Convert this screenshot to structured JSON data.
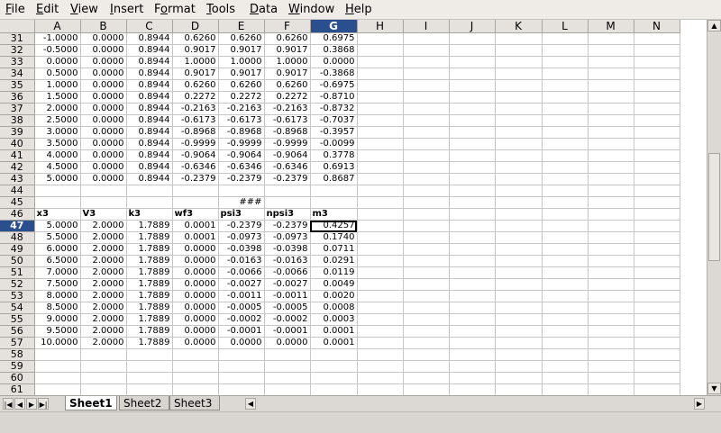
{
  "menu": [
    {
      "pre": "",
      "mn": "F",
      "post": "ile"
    },
    {
      "pre": "",
      "mn": "E",
      "post": "dit"
    },
    {
      "pre": "",
      "mn": "V",
      "post": "iew"
    },
    {
      "pre": "",
      "mn": "I",
      "post": "nsert"
    },
    {
      "pre": "F",
      "mn": "o",
      "post": "rmat"
    },
    {
      "pre": "",
      "mn": "T",
      "post": "ools"
    },
    {
      "pre": "",
      "mn": "D",
      "post": "ata"
    },
    {
      "pre": "",
      "mn": "W",
      "post": "indow"
    },
    {
      "pre": "",
      "mn": "H",
      "post": "elp"
    }
  ],
  "columns": [
    "A",
    "B",
    "C",
    "D",
    "E",
    "F",
    "G",
    "H",
    "I",
    "J",
    "K",
    "L",
    "M",
    "N"
  ],
  "selected_column": "G",
  "selected_row": "47",
  "rows": [
    {
      "n": "31",
      "c": [
        "-1.0000",
        "0.0000",
        "0.8944",
        "0.6260",
        "0.6260",
        "0.6260",
        "0.6975"
      ]
    },
    {
      "n": "32",
      "c": [
        "-0.5000",
        "0.0000",
        "0.8944",
        "0.9017",
        "0.9017",
        "0.9017",
        "0.3868"
      ]
    },
    {
      "n": "33",
      "c": [
        "0.0000",
        "0.0000",
        "0.8944",
        "1.0000",
        "1.0000",
        "1.0000",
        "0.0000"
      ]
    },
    {
      "n": "34",
      "c": [
        "0.5000",
        "0.0000",
        "0.8944",
        "0.9017",
        "0.9017",
        "0.9017",
        "-0.3868"
      ]
    },
    {
      "n": "35",
      "c": [
        "1.0000",
        "0.0000",
        "0.8944",
        "0.6260",
        "0.6260",
        "0.6260",
        "-0.6975"
      ]
    },
    {
      "n": "36",
      "c": [
        "1.5000",
        "0.0000",
        "0.8944",
        "0.2272",
        "0.2272",
        "0.2272",
        "-0.8710"
      ]
    },
    {
      "n": "37",
      "c": [
        "2.0000",
        "0.0000",
        "0.8944",
        "-0.2163",
        "-0.2163",
        "-0.2163",
        "-0.8732"
      ]
    },
    {
      "n": "38",
      "c": [
        "2.5000",
        "0.0000",
        "0.8944",
        "-0.6173",
        "-0.6173",
        "-0.6173",
        "-0.7037"
      ]
    },
    {
      "n": "39",
      "c": [
        "3.0000",
        "0.0000",
        "0.8944",
        "-0.8968",
        "-0.8968",
        "-0.8968",
        "-0.3957"
      ]
    },
    {
      "n": "40",
      "c": [
        "3.5000",
        "0.0000",
        "0.8944",
        "-0.9999",
        "-0.9999",
        "-0.9999",
        "-0.0099"
      ]
    },
    {
      "n": "41",
      "c": [
        "4.0000",
        "0.0000",
        "0.8944",
        "-0.9064",
        "-0.9064",
        "-0.9064",
        "0.3778"
      ]
    },
    {
      "n": "42",
      "c": [
        "4.5000",
        "0.0000",
        "0.8944",
        "-0.6346",
        "-0.6346",
        "-0.6346",
        "0.6913"
      ]
    },
    {
      "n": "43",
      "c": [
        "5.0000",
        "0.0000",
        "0.8944",
        "-0.2379",
        "-0.2379",
        "-0.2379",
        "0.8687"
      ]
    },
    {
      "n": "44",
      "c": [
        "",
        "",
        "",
        "",
        "",
        "",
        ""
      ]
    },
    {
      "n": "45",
      "c": [
        "",
        "",
        "",
        "",
        "###",
        "",
        ""
      ]
    },
    {
      "n": "46",
      "c": [
        "x3",
        "V3",
        "k3",
        "wf3",
        "psi3",
        "npsi3",
        "m3"
      ],
      "header": true
    },
    {
      "n": "47",
      "c": [
        "5.0000",
        "2.0000",
        "1.7889",
        "0.0001",
        "-0.2379",
        "-0.2379",
        "0.4257"
      ]
    },
    {
      "n": "48",
      "c": [
        "5.5000",
        "2.0000",
        "1.7889",
        "0.0001",
        "-0.0973",
        "-0.0973",
        "0.1740"
      ]
    },
    {
      "n": "49",
      "c": [
        "6.0000",
        "2.0000",
        "1.7889",
        "0.0000",
        "-0.0398",
        "-0.0398",
        "0.0711"
      ]
    },
    {
      "n": "50",
      "c": [
        "6.5000",
        "2.0000",
        "1.7889",
        "0.0000",
        "-0.0163",
        "-0.0163",
        "0.0291"
      ]
    },
    {
      "n": "51",
      "c": [
        "7.0000",
        "2.0000",
        "1.7889",
        "0.0000",
        "-0.0066",
        "-0.0066",
        "0.0119"
      ]
    },
    {
      "n": "52",
      "c": [
        "7.5000",
        "2.0000",
        "1.7889",
        "0.0000",
        "-0.0027",
        "-0.0027",
        "0.0049"
      ]
    },
    {
      "n": "53",
      "c": [
        "8.0000",
        "2.0000",
        "1.7889",
        "0.0000",
        "-0.0011",
        "-0.0011",
        "0.0020"
      ]
    },
    {
      "n": "54",
      "c": [
        "8.5000",
        "2.0000",
        "1.7889",
        "0.0000",
        "-0.0005",
        "-0.0005",
        "0.0008"
      ]
    },
    {
      "n": "55",
      "c": [
        "9.0000",
        "2.0000",
        "1.7889",
        "0.0000",
        "-0.0002",
        "-0.0002",
        "0.0003"
      ]
    },
    {
      "n": "56",
      "c": [
        "9.5000",
        "2.0000",
        "1.7889",
        "0.0000",
        "-0.0001",
        "-0.0001",
        "0.0001"
      ]
    },
    {
      "n": "57",
      "c": [
        "10.0000",
        "2.0000",
        "1.7889",
        "0.0000",
        "0.0000",
        "0.0000",
        "0.0001"
      ]
    },
    {
      "n": "58",
      "c": [
        "",
        "",
        "",
        "",
        "",
        "",
        ""
      ]
    },
    {
      "n": "59",
      "c": [
        "",
        "",
        "",
        "",
        "",
        "",
        ""
      ]
    },
    {
      "n": "60",
      "c": [
        "",
        "",
        "",
        "",
        "",
        "",
        ""
      ]
    },
    {
      "n": "61",
      "c": [
        "",
        "",
        "",
        "",
        "",
        "",
        ""
      ]
    }
  ],
  "sheet_tabs": [
    "Sheet1",
    "Sheet2",
    "Sheet3"
  ],
  "active_sheet": "Sheet1",
  "icons": {
    "tab_first": "first-sheet-icon",
    "tab_prev": "prev-sheet-icon",
    "tab_next": "next-sheet-icon",
    "tab_last": "last-sheet-icon"
  }
}
